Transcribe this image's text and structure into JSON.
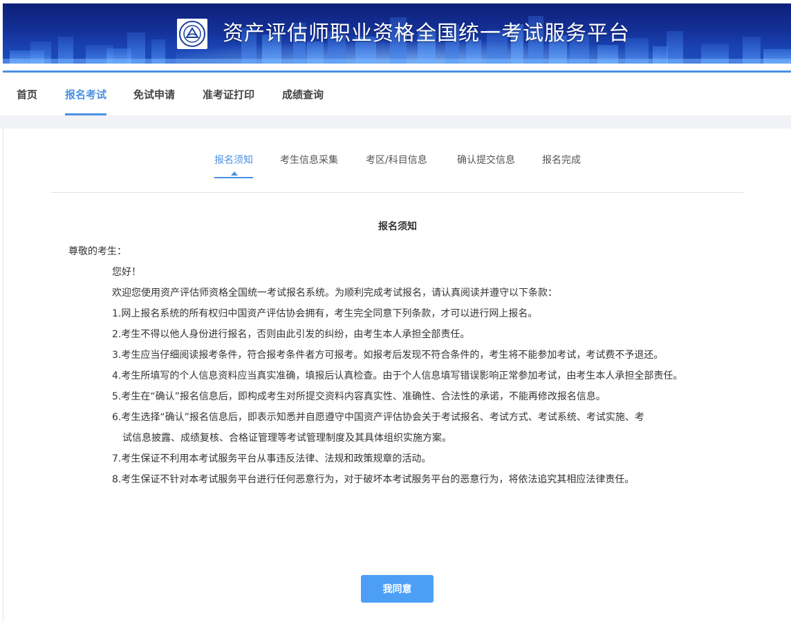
{
  "banner": {
    "title": "资产评估师职业资格全国统一考试服务平台",
    "logo_icon": "association-logo-icon"
  },
  "main_nav": {
    "items": [
      {
        "label": "首页",
        "active": false
      },
      {
        "label": "报名考试",
        "active": true
      },
      {
        "label": "免试申请",
        "active": false
      },
      {
        "label": "准考证打印",
        "active": false
      },
      {
        "label": "成绩查询",
        "active": false
      }
    ]
  },
  "steps": {
    "items": [
      {
        "label": "报名须知",
        "active": true
      },
      {
        "label": "考生信息采集",
        "active": false
      },
      {
        "label": "考区/科目信息",
        "active": false
      },
      {
        "label": "确认提交信息",
        "active": false
      },
      {
        "label": "报名完成",
        "active": false
      }
    ]
  },
  "notice": {
    "title": "报名须知",
    "salutation": "尊敬的考生：",
    "greeting": "您好！",
    "intro": "欢迎您使用资产评估师资格全国统一考试报名系统。为顺利完成考试报名，请认真阅读并遵守以下条款：",
    "items": [
      "1.网上报名系统的所有权归中国资产评估协会拥有，考生完全同意下列条款，才可以进行网上报名。",
      "2.考生不得以他人身份进行报名，否则由此引发的纠纷，由考生本人承担全部责任。",
      "3.考生应当仔细阅读报考条件，符合报考条件者方可报考。如报考后发现不符合条件的，考生将不能参加考试，考试费不予退还。",
      "4.考生所填写的个人信息资料应当真实准确，填报后认真检查。由于个人信息填写错误影响正常参加考试，由考生本人承担全部责任。",
      "5.考生在“确认”报名信息后，即构成考生对所提交资料内容真实性、准确性、合法性的承诺，不能再修改报名信息。",
      "6.考生选择“确认”报名信息后，即表示知悉并自愿遵守中国资产评估协会关于考试报名、考试方式、考试系统、考试实施、考",
      "试信息披露、成绩复核、合格证管理等考试管理制度及其具体组织实施方案。",
      "7.考生保证不利用本考试服务平台从事违反法律、法规和政策规章的活动。",
      "8.考生保证不针对本考试服务平台进行任何恶意行为，对于破坏本考试服务平台的恶意行为，将依法追究其相应法律责任。"
    ]
  },
  "agree_button": {
    "label": "我同意"
  },
  "colors": {
    "accent": "#4a90e2",
    "button": "#4d9ff5",
    "banner": "#143197"
  }
}
